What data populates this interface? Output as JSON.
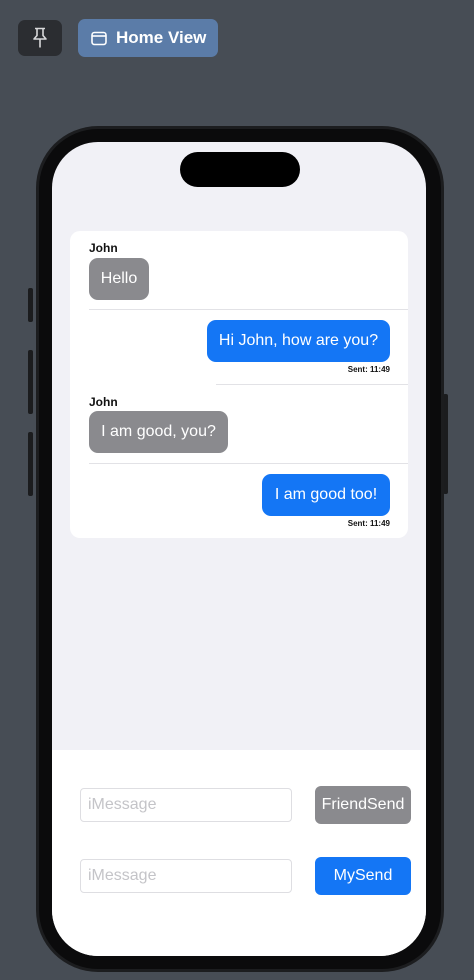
{
  "toolbar": {
    "home_view_label": "Home View"
  },
  "chat": {
    "messages": [
      {
        "from": "friend",
        "sender": "John",
        "text": "Hello"
      },
      {
        "from": "me",
        "text": "Hi John, how are you?",
        "status": "Sent: 11:49"
      },
      {
        "from": "friend",
        "sender": "John",
        "text": "I am good, you?"
      },
      {
        "from": "me",
        "text": "I am good too!",
        "status": "Sent: 11:49"
      }
    ]
  },
  "composer": {
    "friend_placeholder": "iMessage",
    "friend_send_label": "FriendSend",
    "my_placeholder": "iMessage",
    "my_send_label": "MySend"
  },
  "colors": {
    "background": "#474d55",
    "my_bubble": "#1476f5",
    "friend_bubble": "#8a8a8e",
    "home_button": "#5b7ca8"
  }
}
